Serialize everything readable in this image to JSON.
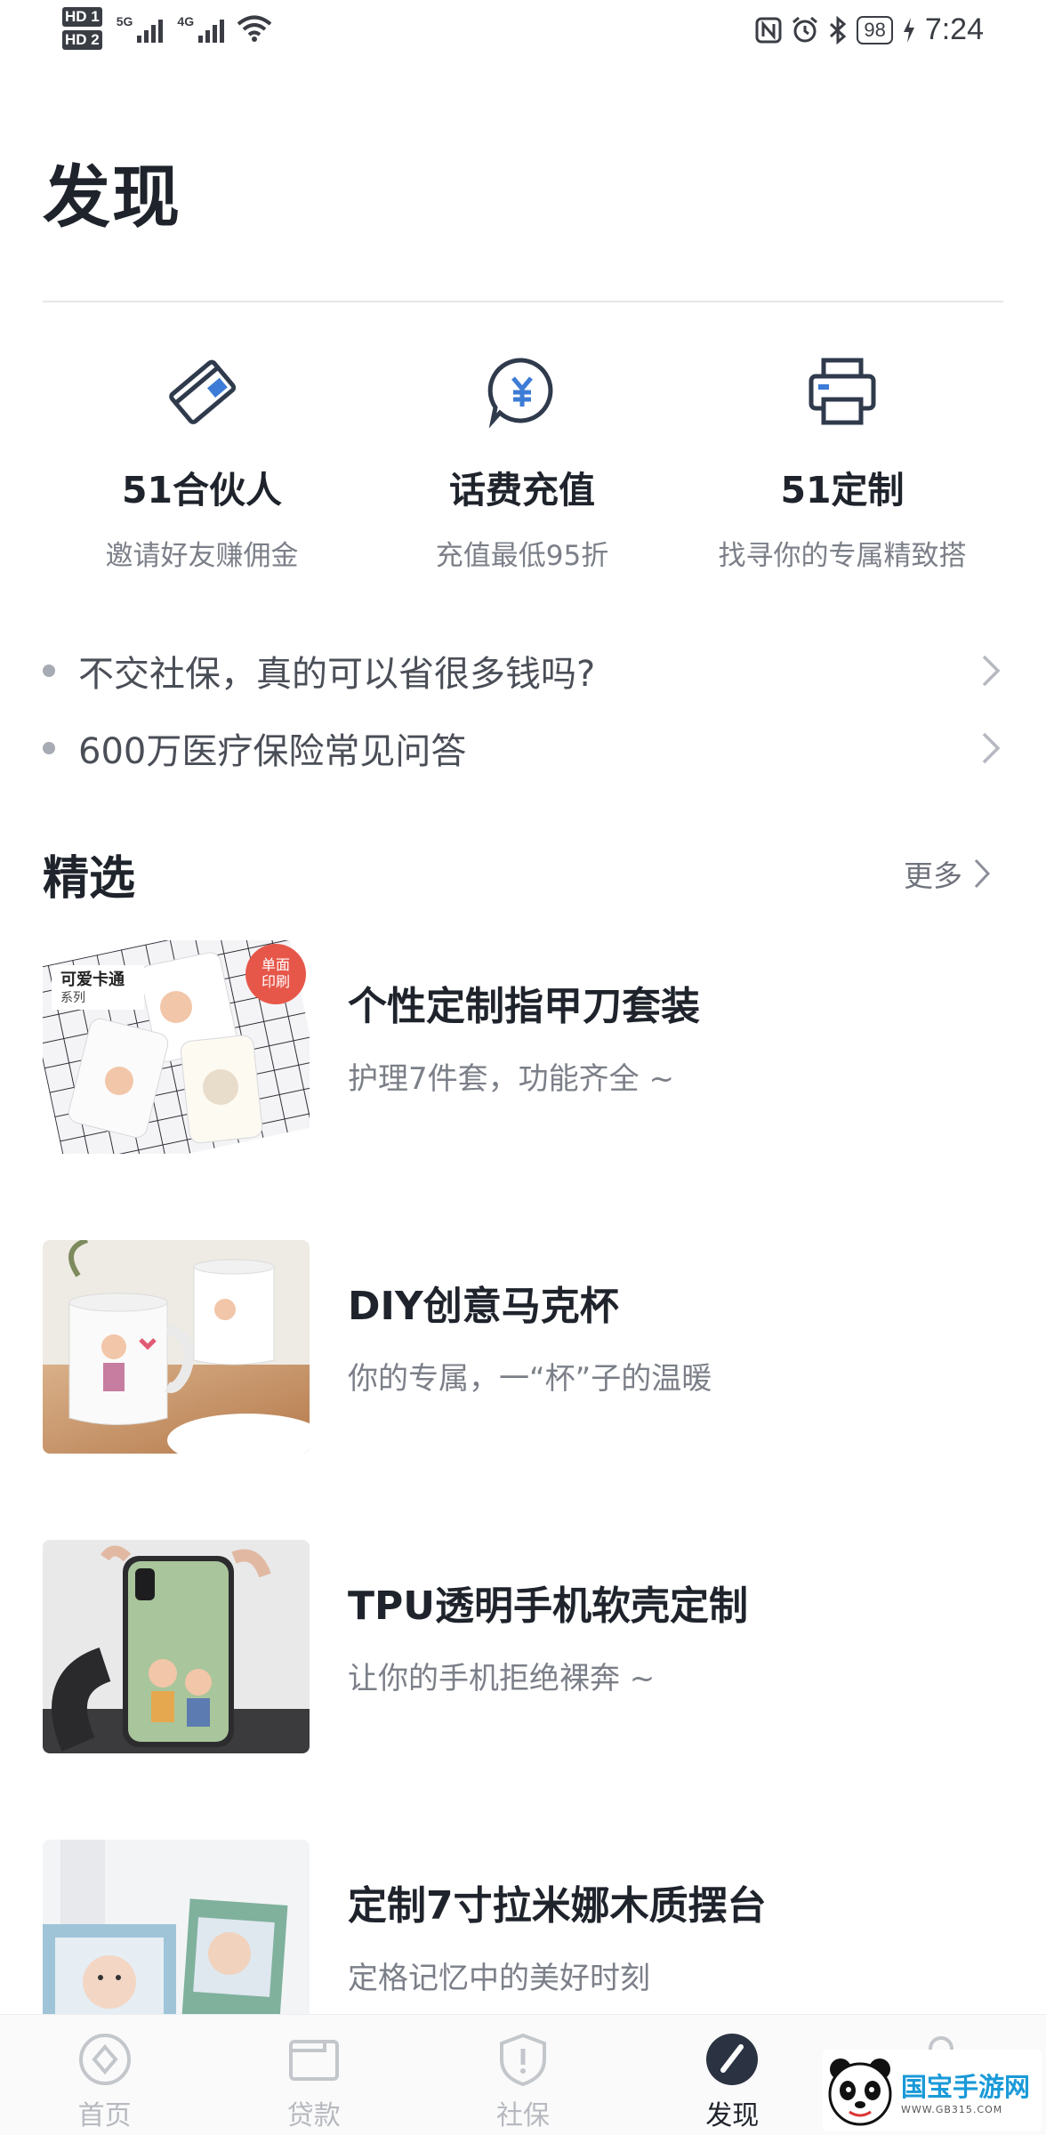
{
  "status_bar": {
    "sim1": "HD 1",
    "sim2": "HD 2",
    "net1": "5G",
    "net2": "4G",
    "battery": "98",
    "time": "7:24"
  },
  "page": {
    "title": "发现"
  },
  "quick_entries": [
    {
      "title": "51合伙人",
      "subtitle": "邀请好友赚佣金",
      "icon": "card-icon"
    },
    {
      "title": "话费充值",
      "subtitle": "充值最低95折",
      "icon": "yuan-bubble-icon"
    },
    {
      "title": "51定制",
      "subtitle": "找寻你的专属精致搭",
      "icon": "printer-icon"
    }
  ],
  "articles": [
    {
      "text": "不交社保，真的可以省很多钱吗?"
    },
    {
      "text": "600万医疗保险常见问答"
    }
  ],
  "featured": {
    "title": "精选",
    "more": "更多",
    "items": [
      {
        "title": "个性定制指甲刀套装",
        "subtitle": "护理7件套，功能齐全 ~",
        "badge": "单面印刷",
        "tag": "可爱卡通",
        "tag_sub": "系列"
      },
      {
        "title": "DIY创意马克杯",
        "subtitle": "你的专属，一“杯”子的温暖"
      },
      {
        "title": "TPU透明手机软壳定制",
        "subtitle": "让你的手机拒绝裸奔 ~"
      },
      {
        "title": "定制7寸拉米娜木质摆台",
        "subtitle": "定格记忆中的美好时刻"
      }
    ]
  },
  "bottom_nav": [
    {
      "label": "首页",
      "icon": "home-icon"
    },
    {
      "label": "贷款",
      "icon": "wallet-icon"
    },
    {
      "label": "社保",
      "icon": "shield-icon"
    },
    {
      "label": "发现",
      "icon": "compass-icon",
      "active": true
    },
    {
      "label": "",
      "icon": "user-icon"
    }
  ],
  "watermark": {
    "text": "国宝手游网",
    "sub": "WWW.GB315.COM"
  },
  "colors": {
    "accent": "#3a5a8c",
    "text_primary": "#1f232b",
    "text_secondary": "#7b7f88",
    "active_nav": "#1f232b"
  }
}
